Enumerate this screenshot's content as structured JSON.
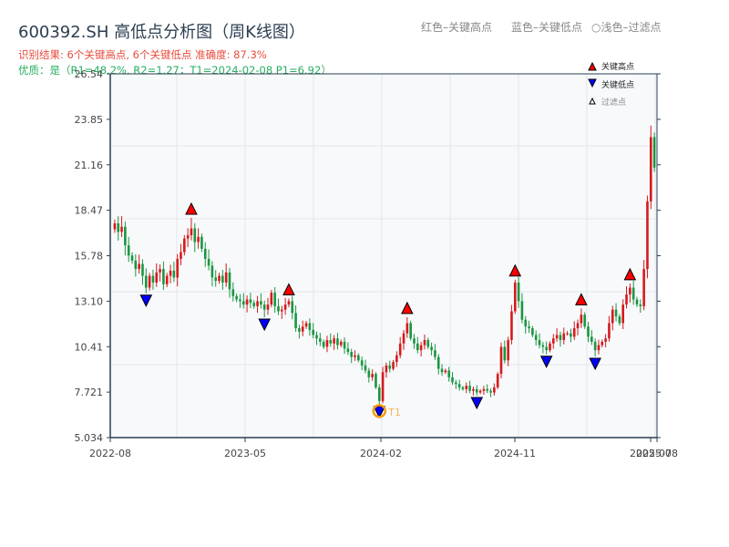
{
  "title": "600392.SH 高低点分析图（周K线图）",
  "result_line": "识别结果: 6个关键高点, 6个关键低点  准确度: 87.3%",
  "quality_line": "优质：是（R1=48.2%, R2=1.27；T1=2024-02-08 P1=6.92）",
  "header_legend": {
    "red": "红色–关键高点",
    "blue": "蓝色–关键低点",
    "light": "○浅色–过滤点"
  },
  "colors": {
    "up": "#d7191c",
    "down": "#1a9641",
    "high_marker": "#ff0000",
    "low_marker": "#0000ff",
    "t1": "#f39c12"
  },
  "chart_data": {
    "type": "candlestick",
    "frequency": "weekly",
    "ylim": [
      5.034,
      26.54
    ],
    "y_ticks": [
      "26.54",
      "23.85",
      "21.16",
      "18.47",
      "15.78",
      "13.10",
      "10.41",
      "7.721",
      "5.034"
    ],
    "x_ticks": [
      "2022-08",
      "2023-05",
      "2024-02",
      "2024-11",
      "2025-07",
      "2025-08"
    ],
    "grid": true,
    "legend": {
      "placement": "top-right",
      "items": [
        "关键高点",
        "关键低点",
        "过滤点"
      ]
    },
    "closes": [
      17.7,
      17.2,
      17.5,
      16.4,
      15.8,
      15.5,
      15.0,
      15.3,
      14.6,
      13.9,
      14.6,
      14.2,
      14.8,
      15.0,
      14.1,
      14.6,
      14.9,
      14.5,
      15.6,
      16.0,
      16.8,
      17.0,
      17.4,
      16.6,
      16.9,
      16.2,
      15.6,
      15.2,
      14.5,
      14.3,
      14.6,
      14.2,
      14.8,
      13.8,
      13.4,
      13.2,
      13.1,
      12.9,
      13.2,
      13.0,
      12.8,
      13.1,
      12.9,
      12.6,
      12.9,
      13.6,
      12.8,
      12.5,
      12.6,
      12.9,
      13.1,
      12.4,
      11.5,
      11.3,
      11.6,
      11.8,
      11.4,
      11.1,
      10.9,
      10.7,
      10.4,
      10.8,
      10.6,
      10.9,
      10.5,
      10.7,
      10.3,
      10.1,
      9.8,
      9.9,
      9.6,
      9.3,
      9.0,
      8.6,
      8.8,
      8.0,
      7.2,
      8.9,
      9.3,
      9.1,
      9.5,
      9.9,
      10.6,
      11.2,
      11.8,
      10.9,
      10.6,
      10.2,
      10.5,
      10.8,
      10.4,
      10.2,
      9.8,
      9.1,
      8.9,
      9.0,
      8.6,
      8.3,
      8.2,
      8.0,
      7.9,
      8.1,
      7.8,
      7.9,
      7.7,
      7.8,
      7.9,
      7.8,
      7.7,
      8.0,
      8.8,
      10.4,
      9.6,
      10.8,
      12.5,
      14.2,
      13.1,
      12.0,
      11.6,
      11.5,
      11.1,
      10.8,
      10.5,
      10.4,
      10.2,
      10.6,
      10.9,
      11.1,
      10.8,
      11.2,
      11.2,
      11.0,
      11.5,
      11.8,
      12.3,
      11.6,
      11.0,
      10.7,
      10.2,
      10.5,
      10.7,
      10.9,
      11.8,
      12.6,
      12.2,
      11.8,
      12.9,
      13.5,
      13.9,
      13.2,
      12.9,
      12.8,
      15.0,
      19.0,
      22.8,
      21.0
    ],
    "key_high_weeks": [
      22,
      50,
      84,
      115,
      134,
      148
    ],
    "key_low_weeks": [
      9,
      43,
      76,
      104,
      124,
      138
    ],
    "t1": {
      "label": "T1",
      "week": 76,
      "date": "2024-02-08",
      "price": 6.92
    }
  }
}
